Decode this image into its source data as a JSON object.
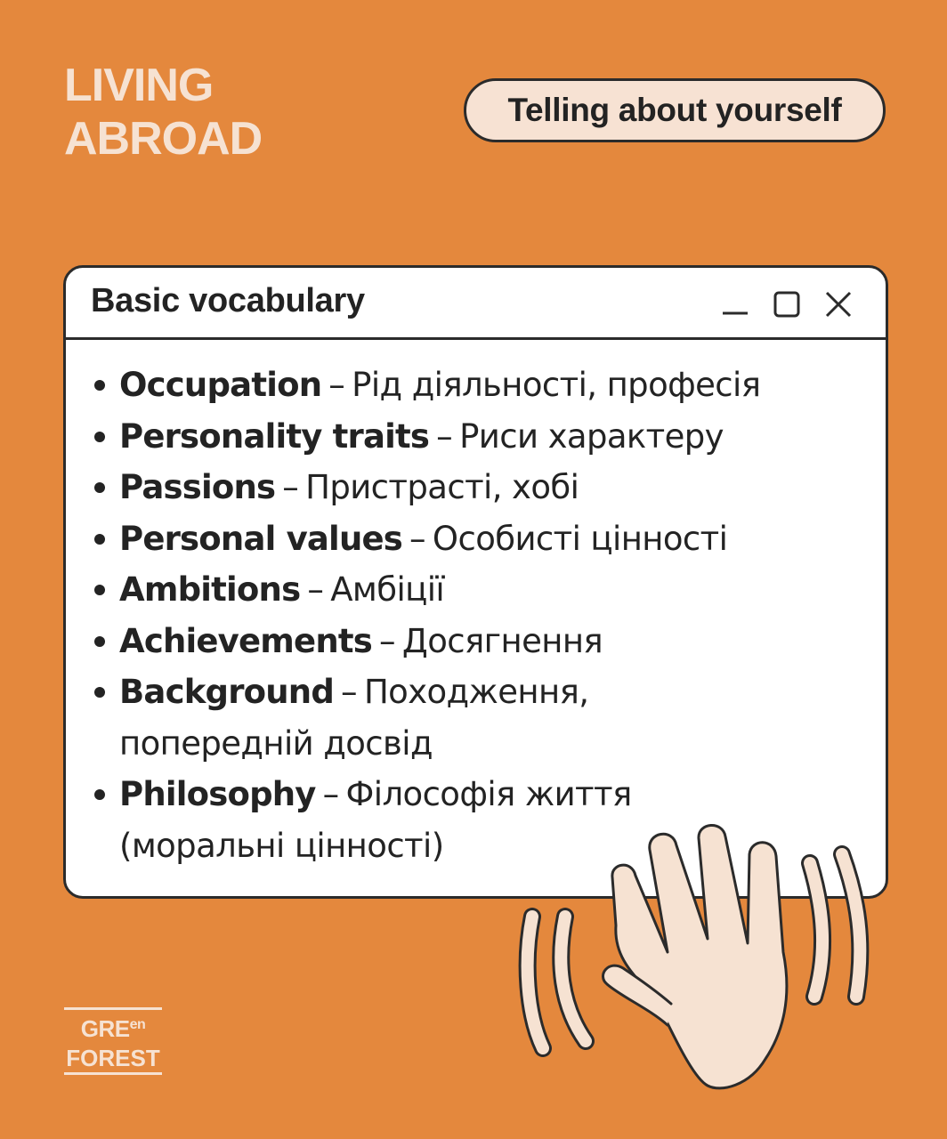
{
  "header": {
    "title_line1": "LIVING",
    "title_line2": "ABROAD",
    "topic": "Telling about yourself"
  },
  "window": {
    "title": "Basic vocabulary",
    "controls": [
      "minimize-icon",
      "maximize-icon",
      "close-icon"
    ]
  },
  "vocabulary": [
    {
      "term": "Occupation",
      "translation": "Рід діяльності, професія"
    },
    {
      "term": "Personality traits",
      "translation": "Риси характеру"
    },
    {
      "term": "Passions",
      "translation": "Пристрасті, хобі"
    },
    {
      "term": "Personal values",
      "translation": "Особисті цінності"
    },
    {
      "term": "Ambitions",
      "translation": "Амбіції"
    },
    {
      "term": "Achievements",
      "translation": "Досягнення"
    },
    {
      "term": "Background",
      "translation": "Походження,",
      "translation_cont": "попередній досвід"
    },
    {
      "term": "Philosophy",
      "translation": "Філософія життя",
      "translation_cont": "(моральні цінності)"
    }
  ],
  "separator": "–",
  "logo": {
    "top": "GRE",
    "top_small": "en",
    "bottom": "FOREST"
  },
  "colors": {
    "background": "#E4883D",
    "cream": "#F6E2D2",
    "outline": "#2B2B2B",
    "window_bg": "#FFFFFF"
  },
  "decoration": "waving-hand-icon"
}
